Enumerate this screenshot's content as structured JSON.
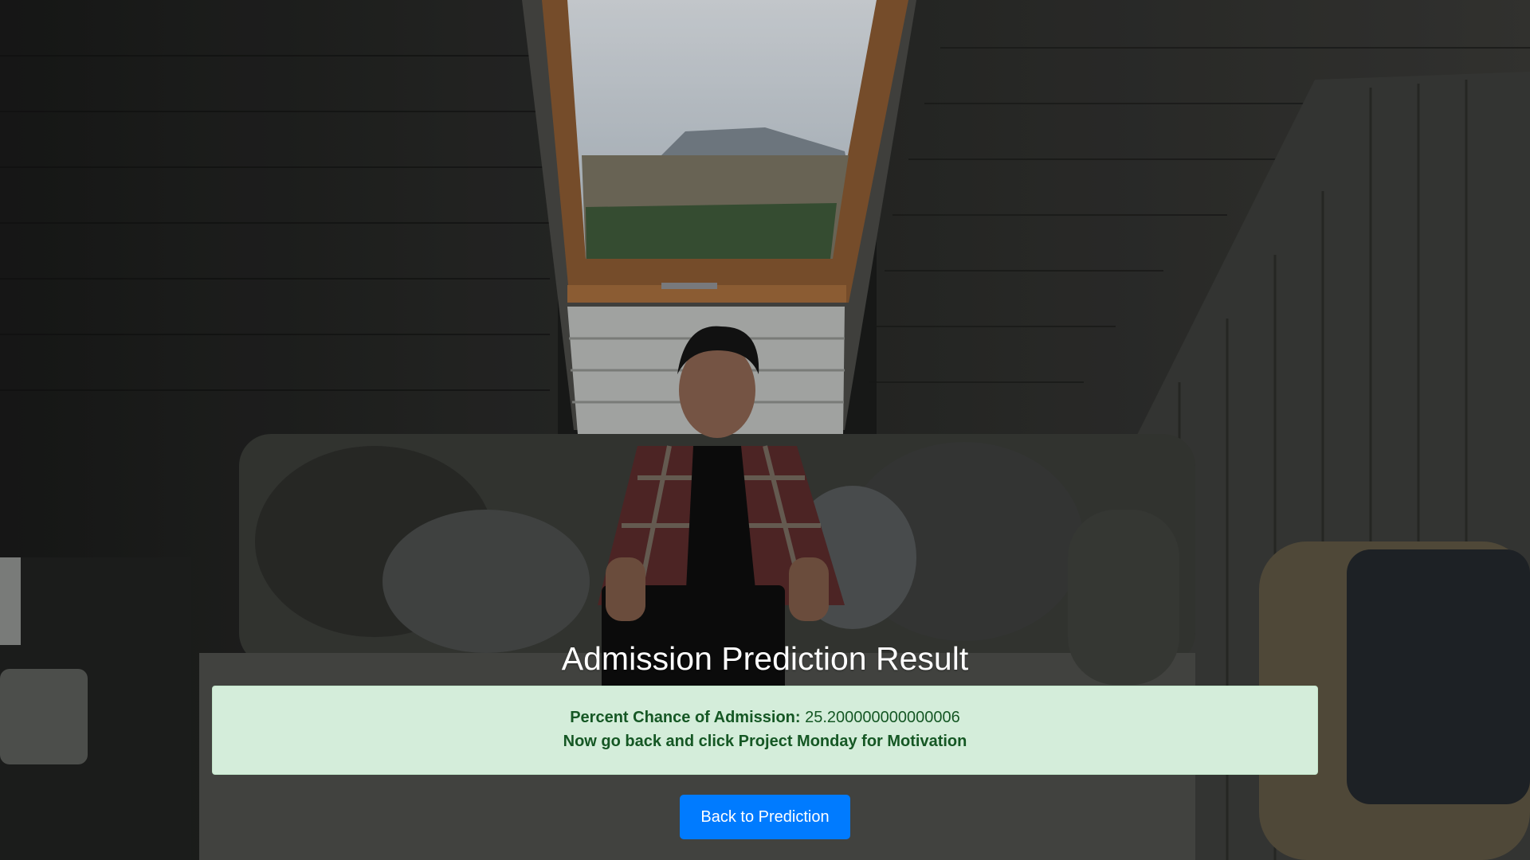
{
  "page": {
    "title": "Admission Prediction Result"
  },
  "result": {
    "label": "Percent Chance of Admission:",
    "value": "25.200000000000006",
    "message": "Now go back and click Project Monday for Motivation"
  },
  "actions": {
    "back_label": "Back to Prediction"
  },
  "colors": {
    "alert_background": "#d4edda",
    "alert_text": "#155724",
    "button_primary": "#007bff",
    "title_text": "#ffffff"
  },
  "background_image": {
    "icon": "attic-room-photo"
  }
}
